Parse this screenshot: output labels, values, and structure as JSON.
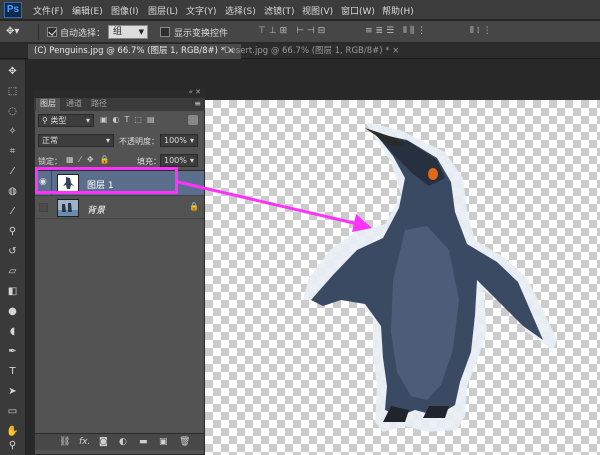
{
  "app": {
    "logo": "Ps"
  },
  "menu": [
    "文件(F)",
    "编辑(E)",
    "图像(I)",
    "图层(L)",
    "文字(Y)",
    "选择(S)",
    "滤镜(T)",
    "视图(V)",
    "窗口(W)",
    "帮助(H)"
  ],
  "options": {
    "auto_select_label": "自动选择：",
    "auto_select_checked": true,
    "auto_select_target": "组",
    "show_transform_label": "显示变换控件",
    "show_transform_checked": false
  },
  "tabs": [
    {
      "label": "(C) Penguins.jpg @ 66.7% (图层 1, RGB/8#) *",
      "close": "×",
      "active": true
    },
    {
      "label": "Desert.jpg @ 66.7% (图层 1, RGB/8#) *",
      "close": "×",
      "active": false
    }
  ],
  "layers_panel": {
    "tabs": [
      "图层",
      "通道",
      "路径"
    ],
    "filter_label": "类型",
    "blend_mode": "正常",
    "opacity_label": "不透明度：",
    "opacity_value": "100%",
    "lock_label": "锁定：",
    "fill_label": "填充：",
    "fill_value": "100%",
    "layers": [
      {
        "name": "图层 1",
        "selected": true,
        "visible": true,
        "locked": false
      },
      {
        "name": "背景",
        "selected": false,
        "visible": false,
        "locked": true
      }
    ],
    "bottom_icons": [
      "link-icon",
      "fx-icon",
      "mask-icon",
      "adjustment-icon",
      "group-icon",
      "new-layer-icon",
      "trash-icon"
    ],
    "bottom_fx_label": "fx."
  },
  "annotation": {
    "color": "#ff33ff"
  },
  "colors": {
    "accent": "#4fa3ff",
    "selection_row": "#5b6e8c",
    "highlight": "#ff33ff"
  }
}
